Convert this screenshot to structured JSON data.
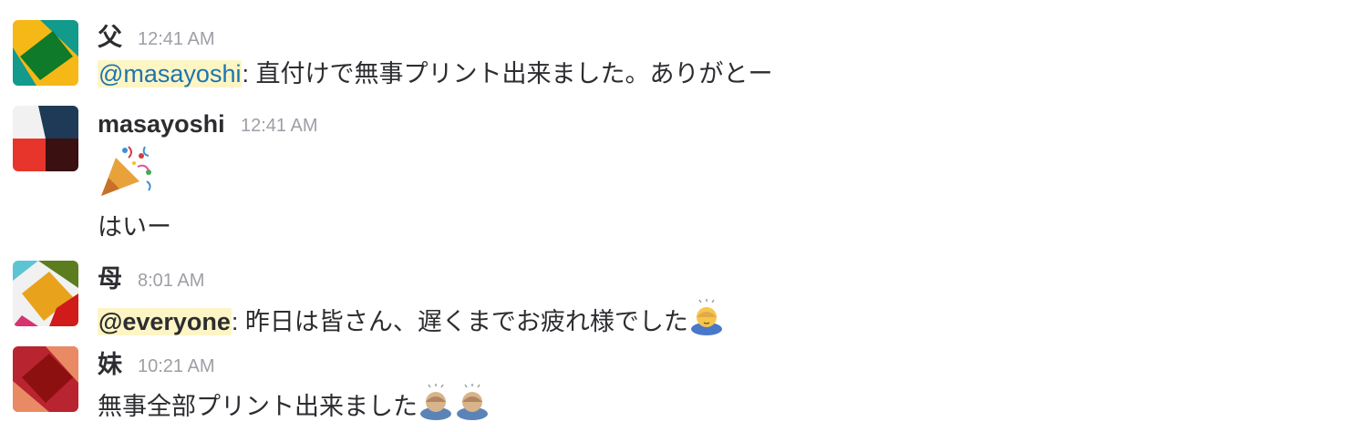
{
  "messages": [
    {
      "sender": "父",
      "time": "12:41 AM",
      "mention": "@masayoshi",
      "text": ": 直付けで無事プリント出来ました。ありがとー",
      "avatar_icon": "avatar-father"
    },
    {
      "sender": "masayoshi",
      "time": "12:41 AM",
      "emoji": "party-popper-icon",
      "text": "はいー",
      "avatar_icon": "avatar-masayoshi"
    },
    {
      "sender": "母",
      "time": "8:01 AM",
      "mention": "@everyone",
      "text": ": 昨日は皆さん、遅くまでお疲れ様でした",
      "emoji": "bowing-person-icon",
      "avatar_icon": "avatar-mother"
    },
    {
      "sender": "妹",
      "time": "10:21 AM",
      "text": "無事全部プリント出来ました",
      "emojis": [
        "bowing-person-icon",
        "bowing-person-icon"
      ],
      "avatar_icon": "avatar-sister"
    }
  ],
  "colors": {
    "mention_bg": "#fef5c5",
    "mention_text": "#1d75ae",
    "timestamp": "#9e9ea6",
    "text": "#2c2d30"
  }
}
